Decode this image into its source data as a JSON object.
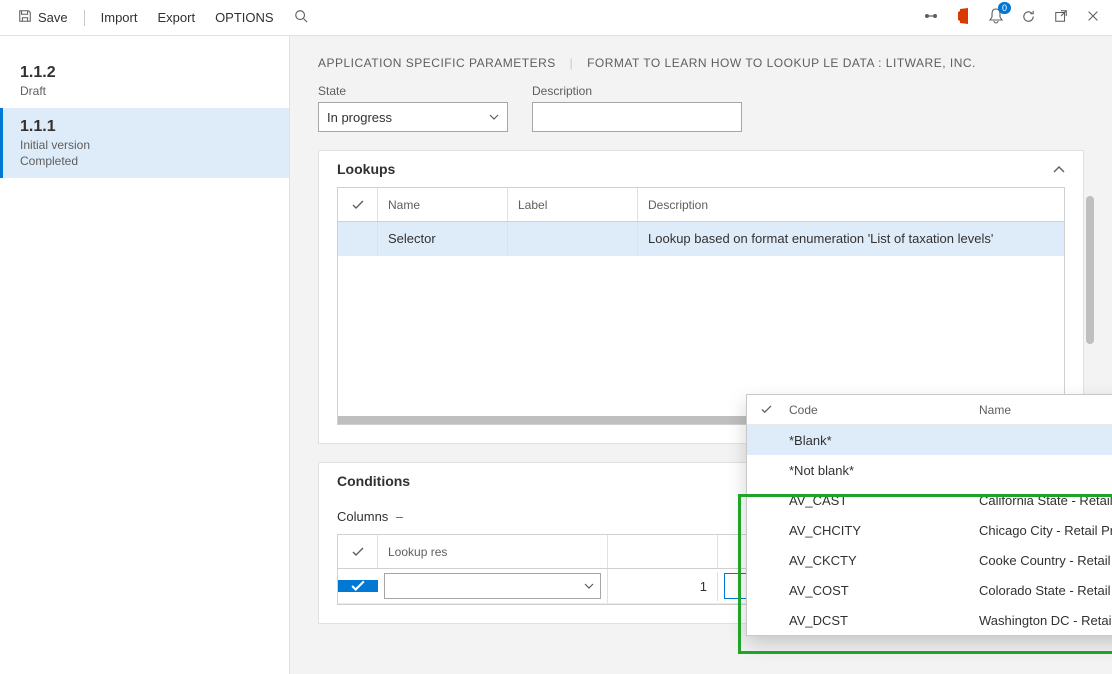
{
  "toolbar": {
    "save": "Save",
    "import": "Import",
    "export": "Export",
    "options": "OPTIONS",
    "notification_count": "0"
  },
  "sidebar": {
    "items": [
      {
        "version": "1.1.2",
        "line1": "Draft",
        "line2": ""
      },
      {
        "version": "1.1.1",
        "line1": "Initial version",
        "line2": "Completed"
      }
    ]
  },
  "breadcrumb": {
    "part1": "APPLICATION SPECIFIC PARAMETERS",
    "part2": "FORMAT TO LEARN HOW TO LOOKUP LE DATA : LITWARE, INC."
  },
  "form": {
    "state_label": "State",
    "state_value": "In progress",
    "description_label": "Description",
    "description_value": ""
  },
  "lookups": {
    "title": "Lookups",
    "columns": {
      "name": "Name",
      "label": "Label",
      "description": "Description"
    },
    "rows": [
      {
        "name": "Selector",
        "label": "",
        "description": "Lookup based on format enumeration 'List of taxation levels'"
      }
    ]
  },
  "conditions": {
    "title": "Conditions",
    "toolbar": {
      "columns": "Columns"
    },
    "columns": {
      "lookup_result": "Lookup res",
      "line": "1"
    },
    "active_line": "1"
  },
  "popup": {
    "columns": {
      "code": "Code",
      "name": "Name"
    },
    "rows": [
      {
        "code": "*Blank*",
        "name": ""
      },
      {
        "code": "*Not blank*",
        "name": ""
      },
      {
        "code": "AV_CAST",
        "name": "California State - Retail Prod"
      },
      {
        "code": "AV_CHCITY",
        "name": "Chicago City - Retail Prod"
      },
      {
        "code": "AV_CKCTY",
        "name": "Cooke Country - Retail Prod"
      },
      {
        "code": "AV_COST",
        "name": "Colorado State - Retail Prod"
      },
      {
        "code": "AV_DCST",
        "name": "Washington DC - Retail Prod"
      }
    ]
  }
}
